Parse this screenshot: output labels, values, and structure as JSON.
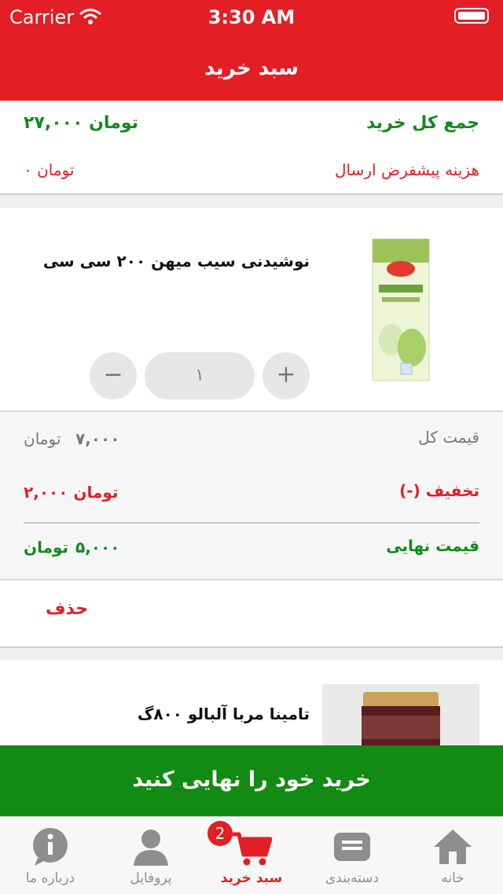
{
  "status": {
    "carrier": "Carrier",
    "time": "3:30 AM"
  },
  "nav": {
    "title": "سبد خرید"
  },
  "summary": {
    "total_label": "جمع کل خرید",
    "total_value": "۲۷,۰۰۰ تومان",
    "shipping_label": "هزینه پیشفرض ارسال",
    "shipping_value": "۰ تومان"
  },
  "items": [
    {
      "name": "نوشیدنی سیب میهن ۲۰۰ سی سی",
      "quantity": "۱",
      "price_label": "قیمت کل",
      "price_value": "۷,۰۰۰",
      "currency": "تومان",
      "discount_label": "(-) تخفیف",
      "discount_value": "۲,۰۰۰ تومان",
      "final_label": "قیمت نهایی",
      "final_value": "۵,۰۰۰",
      "delete_label": "حذف"
    },
    {
      "name": "تامینا مربا آلبالو ۸۰۰گ"
    }
  ],
  "checkout": {
    "label": "خرید خود را نهایی کنید"
  },
  "tabbar": {
    "badge": "2",
    "tabs": [
      {
        "label": "درباره ما",
        "icon": "info-icon"
      },
      {
        "label": "پروفایل",
        "icon": "profile-icon"
      },
      {
        "label": "سبد خرید",
        "icon": "cart-icon",
        "active": true
      },
      {
        "label": "دسته‌بندی",
        "icon": "category-icon"
      },
      {
        "label": "خانه",
        "icon": "home-icon"
      }
    ]
  },
  "colors": {
    "brand_red": "#e31e24",
    "accent_green": "#118a1c",
    "cta_green": "#138a13"
  }
}
